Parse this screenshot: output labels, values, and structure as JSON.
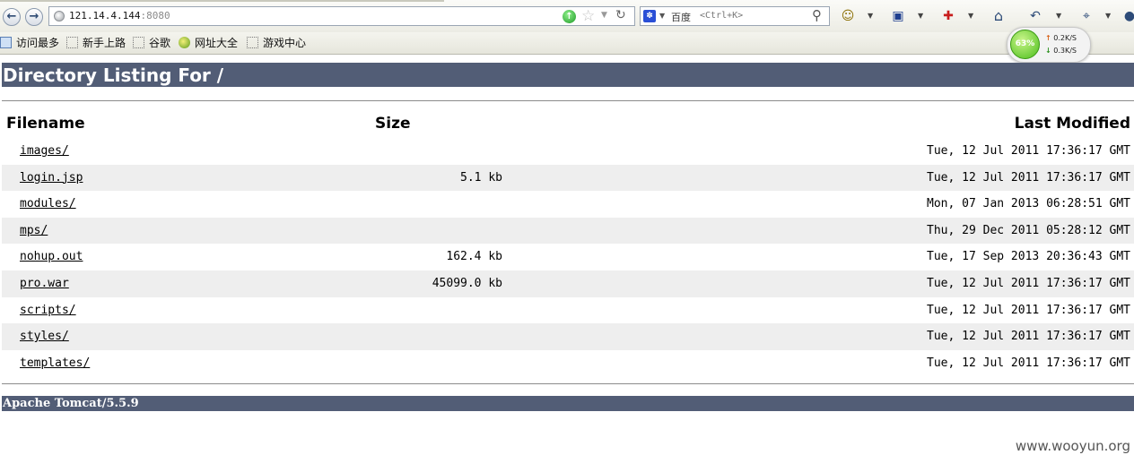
{
  "browser": {
    "url_host": "121.14.4.144",
    "url_port": ":8080",
    "search": {
      "engine_label": "百度",
      "placeholder": "<Ctrl+K>"
    }
  },
  "bookmarks": [
    {
      "label": "访问最多"
    },
    {
      "label": "新手上路"
    },
    {
      "label": "谷歌"
    },
    {
      "label": "网址大全"
    },
    {
      "label": "游戏中心"
    }
  ],
  "speed_widget": {
    "percent": "63%",
    "upload": "0.2K/S",
    "download": "0.3K/S"
  },
  "page": {
    "title": "Directory Listing For /",
    "columns": {
      "filename": "Filename",
      "size": "Size",
      "last_modified": "Last Modified"
    },
    "rows": [
      {
        "name": "images/",
        "size": "",
        "modified": "Tue, 12 Jul 2011 17:36:17 GMT"
      },
      {
        "name": "login.jsp",
        "size": "5.1 kb",
        "modified": "Tue, 12 Jul 2011 17:36:17 GMT"
      },
      {
        "name": "modules/",
        "size": "",
        "modified": "Mon, 07 Jan 2013 06:28:51 GMT"
      },
      {
        "name": "mps/",
        "size": "",
        "modified": "Thu, 29 Dec 2011 05:28:12 GMT"
      },
      {
        "name": "nohup.out",
        "size": "162.4 kb",
        "modified": "Tue, 17 Sep 2013 20:36:43 GMT"
      },
      {
        "name": "pro.war",
        "size": "45099.0 kb",
        "modified": "Tue, 12 Jul 2011 17:36:17 GMT"
      },
      {
        "name": "scripts/",
        "size": "",
        "modified": "Tue, 12 Jul 2011 17:36:17 GMT"
      },
      {
        "name": "styles/",
        "size": "",
        "modified": "Tue, 12 Jul 2011 17:36:17 GMT"
      },
      {
        "name": "templates/",
        "size": "",
        "modified": "Tue, 12 Jul 2011 17:36:17 GMT"
      }
    ],
    "footer": "Apache Tomcat/5.5.9"
  },
  "watermark": "www.wooyun.org",
  "colors": {
    "header_bar": "#525d76",
    "row_shade": "#eeeeee"
  }
}
